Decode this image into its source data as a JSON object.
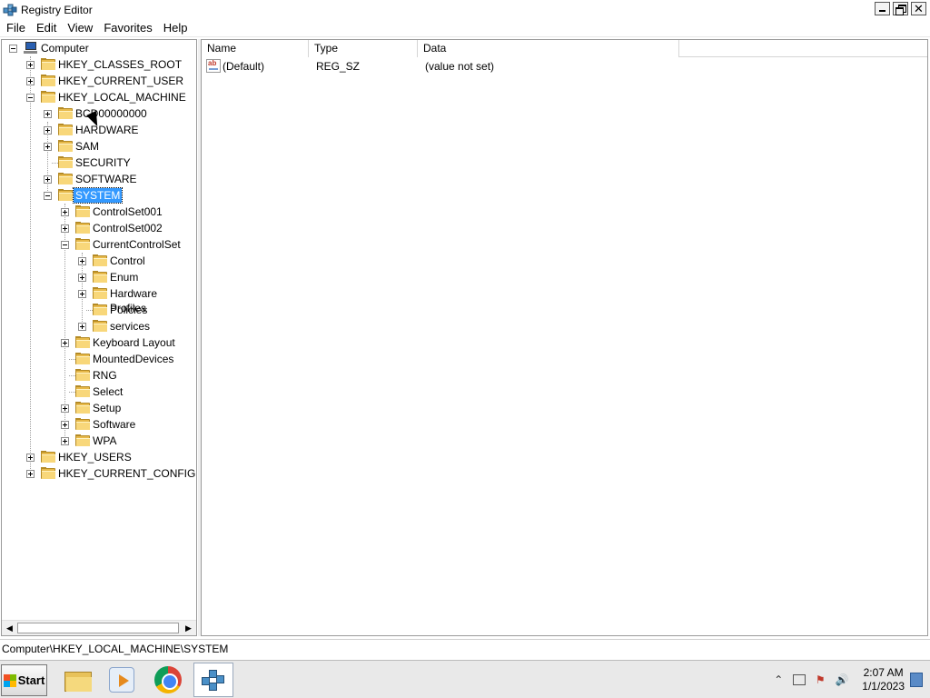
{
  "window": {
    "title": "Registry Editor",
    "close_glyph": "✕"
  },
  "menu": [
    "File",
    "Edit",
    "View",
    "Favorites",
    "Help"
  ],
  "tree": {
    "root": "Computer",
    "hkcr": "HKEY_CLASSES_ROOT",
    "hkcu": "HKEY_CURRENT_USER",
    "hklm": "HKEY_LOCAL_MACHINE",
    "bcd": "BCD00000000",
    "hardware": "HARDWARE",
    "sam": "SAM",
    "security": "SECURITY",
    "software": "SOFTWARE",
    "system": "SYSTEM",
    "controlset001": "ControlSet001",
    "controlset002": "ControlSet002",
    "currentcontrolset": "CurrentControlSet",
    "control": "Control",
    "enum": "Enum",
    "hardware_profiles": "Hardware Profiles",
    "policies": "Policies",
    "services": "services",
    "keyboard_layout": "Keyboard Layout",
    "mounted_devices": "MountedDevices",
    "rng": "RNG",
    "select": "Select",
    "setup": "Setup",
    "software_sub": "Software",
    "wpa": "WPA",
    "hku": "HKEY_USERS",
    "hkcc": "HKEY_CURRENT_CONFIG",
    "selected": "SYSTEM"
  },
  "list": {
    "columns": {
      "name": "Name",
      "type": "Type",
      "data": "Data"
    },
    "rows": [
      {
        "icon": "reg-sz-icon",
        "icon_text": "ab",
        "name": "(Default)",
        "type": "REG_SZ",
        "data": "(value not set)"
      }
    ]
  },
  "statusbar": {
    "path": "Computer\\HKEY_LOCAL_MACHINE\\SYSTEM"
  },
  "taskbar": {
    "start_label": "Start",
    "clock_time": "2:07 AM",
    "clock_date": "1/1/2023",
    "tray_chevron": "⌃",
    "tray_volume": "🔊",
    "tray_flag": "⚑"
  },
  "colors": {
    "selection": "#3399ff",
    "folder": "#f8d77a"
  }
}
